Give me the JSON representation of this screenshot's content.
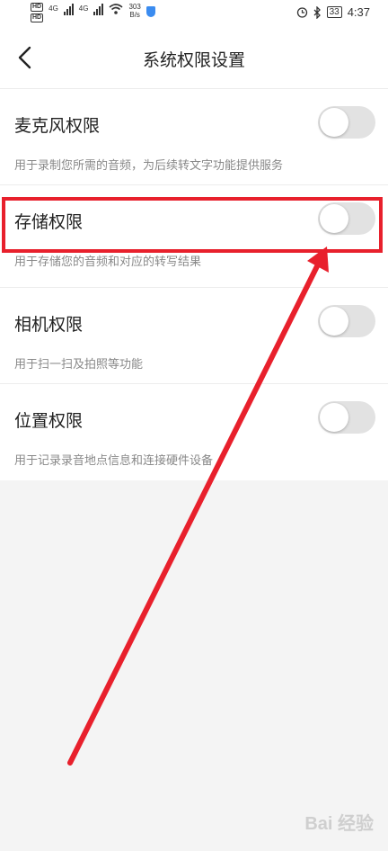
{
  "status_bar": {
    "left_badges": [
      "HD",
      "HD"
    ],
    "net_speed": "303",
    "net_unit": "B/s",
    "sim_labels": [
      "4G",
      "4G"
    ],
    "battery": "33",
    "time": "4:37"
  },
  "header": {
    "title": "系统权限设置"
  },
  "permissions": [
    {
      "label": "麦克风权限",
      "description": "用于录制您所需的音频，为后续转文字功能提供服务",
      "enabled": false
    },
    {
      "label": "存储权限",
      "description": "用于存储您的音频和对应的转写结果",
      "enabled": false
    },
    {
      "label": "相机权限",
      "description": "用于扫一扫及拍照等功能",
      "enabled": false
    },
    {
      "label": "位置权限",
      "description": "用于记录录音地点信息和连接硬件设备",
      "enabled": false
    }
  ],
  "colors": {
    "annotation": "#e8202c",
    "toggle_off": "#e2e2e2",
    "background": "#f4f4f4"
  },
  "watermark": "Bai 经验"
}
